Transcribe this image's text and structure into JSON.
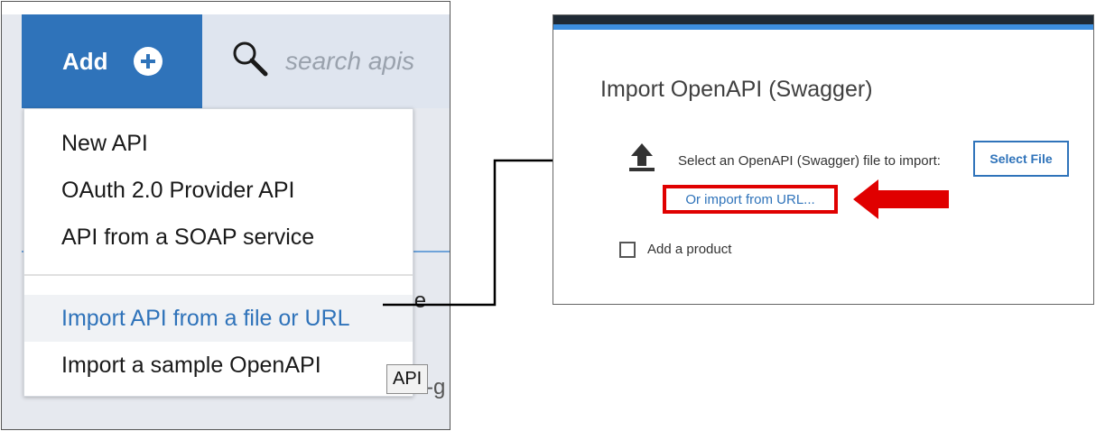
{
  "left_panel": {
    "add_button": {
      "label": "Add"
    },
    "search": {
      "placeholder": "search apis"
    },
    "dropdown": {
      "items": [
        {
          "label": "New API"
        },
        {
          "label": "OAuth 2.0 Provider API"
        },
        {
          "label": "API from a SOAP service"
        },
        {
          "label": "Import API from a file or URL"
        },
        {
          "label": "Import a sample OpenAPI"
        }
      ]
    },
    "background_fragments": {
      "partial_text": "nne",
      "partial_text2": "-g"
    },
    "tooltip": "API"
  },
  "dialog": {
    "title": "Import OpenAPI (Swagger)",
    "select_label": "Select an OpenAPI (Swagger) file to import:",
    "select_file_button": "Select File",
    "import_url_link": "Or import from URL...",
    "add_product_label": "Add a product"
  },
  "colors": {
    "primary_blue": "#2f73ba",
    "highlight_red": "#e00000",
    "dialog_topbar": "#1f2a35"
  },
  "icons": {
    "add": "plus-circle-icon",
    "search": "search-icon",
    "upload": "upload-icon",
    "arrow": "red-arrow-icon"
  }
}
